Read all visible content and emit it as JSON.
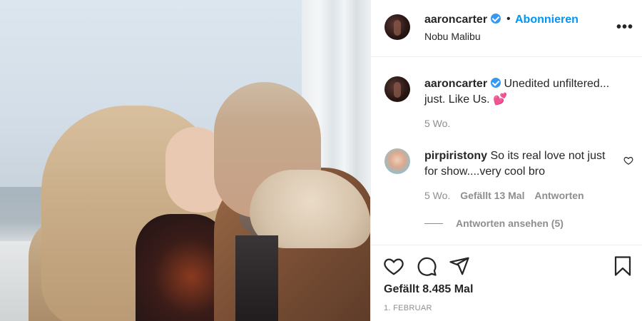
{
  "post": {
    "username": "aaroncarter",
    "follow_label": "Abonnieren",
    "separator": "•",
    "location": "Nobu Malibu",
    "more_label": "•••"
  },
  "caption": {
    "username": "aaroncarter",
    "text": "Unedited unfiltered... just. Like Us. 💕",
    "time": "5 Wo."
  },
  "comment": {
    "username": "pirpiristony",
    "text": "So its real love not just for show....very cool bro",
    "time": "5 Wo.",
    "likes": "Gefällt 13 Mal",
    "reply_label": "Antworten",
    "view_replies": "Antworten ansehen (5)"
  },
  "actions": {
    "likes": "Gefällt 8.485 Mal",
    "date": "1. FEBRUAR"
  },
  "icons": [
    "verified-badge-icon",
    "more-options-icon",
    "heart-icon",
    "comment-icon",
    "share-icon",
    "bookmark-icon"
  ],
  "colors": {
    "link_blue": "#0095f6",
    "verified_blue": "#3897f0",
    "text": "#262626",
    "muted": "#8e8e8e",
    "divider": "#efefef"
  }
}
